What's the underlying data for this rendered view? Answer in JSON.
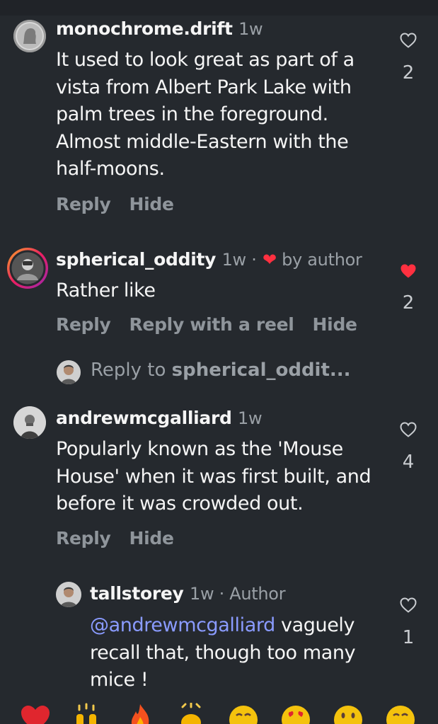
{
  "comments": [
    {
      "username": "monochrome.drift",
      "time": "1w",
      "text": "It used to look great as part of a vista from Albert Park Lake with palm trees in the foreground. Almost middle-Eastern with the half-moons.",
      "actions": [
        "Reply",
        "Hide"
      ],
      "likes": "2",
      "liked": false
    },
    {
      "username": "spherical_oddity",
      "time": "1w ·",
      "by_author": "by author",
      "text": "Rather like",
      "actions": [
        "Reply",
        "Reply with a reel",
        "Hide"
      ],
      "likes": "2",
      "liked": true
    },
    {
      "username": "andrewmcgalliard",
      "time": "1w",
      "text": "Popularly known as the 'Mouse House' when it was first built, and before it was crowded out.",
      "actions": [
        "Reply",
        "Hide"
      ],
      "likes": "4",
      "liked": false
    },
    {
      "username": "tallstorey",
      "time": "1w · Author",
      "mention": "@andrewmcgalliard",
      "text": " vaguely recall that, though too many mice !",
      "likes": "1",
      "liked": false
    }
  ],
  "reply_to": {
    "prefix": "Reply to ",
    "target": "spherical_oddit..."
  },
  "colors": {
    "background": "#25292e",
    "liked_heart": "#ff3040",
    "mention": "#8a9bff",
    "muted": "#9aa0a6"
  },
  "icons": {
    "like": "heart-outline-icon",
    "liked": "heart-filled-icon"
  }
}
